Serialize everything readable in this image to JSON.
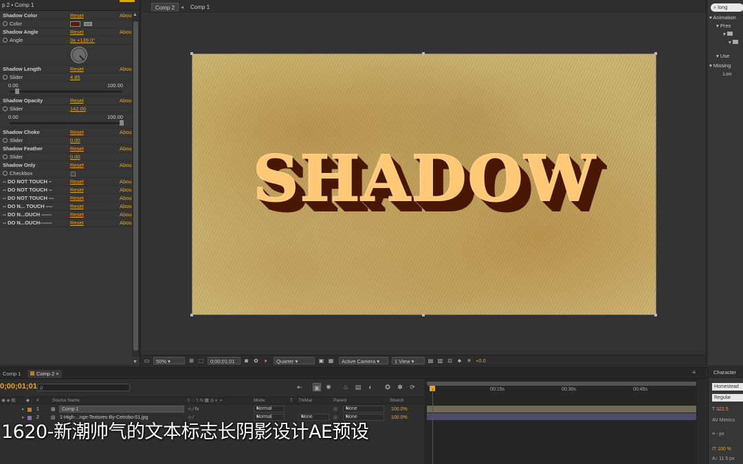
{
  "effect_controls": {
    "header": "p 2 • Comp 1",
    "rows": [
      {
        "type": "group",
        "name": "Shadow Color",
        "reset": "Reset",
        "about": "Abou"
      },
      {
        "type": "color",
        "name": "Color"
      },
      {
        "type": "group",
        "name": "Shadow Angle",
        "reset": "Reset",
        "about": "Abou"
      },
      {
        "type": "value",
        "name": "Angle",
        "value": "0x +139.0°"
      },
      {
        "type": "dial"
      },
      {
        "type": "group",
        "name": "Shadow Length",
        "reset": "Reset",
        "about": "Abou"
      },
      {
        "type": "value",
        "name": "Slider",
        "value": "4.85"
      },
      {
        "type": "range",
        "lo": "0.00",
        "hi": "100.00",
        "fraction": 0.05
      },
      {
        "type": "group",
        "name": "Shadow Opacity",
        "reset": "Reset",
        "about": "Abou"
      },
      {
        "type": "value",
        "name": "Slider",
        "value": "142.00"
      },
      {
        "type": "range",
        "lo": "0.00",
        "hi": "100.00",
        "fraction": 1.0
      },
      {
        "type": "group",
        "name": "Shadow Choke",
        "reset": "Reset",
        "about": "Abou"
      },
      {
        "type": "value",
        "name": "Slider",
        "value": "0.00"
      },
      {
        "type": "group",
        "name": "Shadow Feather",
        "reset": "Reset",
        "about": "Abou"
      },
      {
        "type": "value",
        "name": "Slider",
        "value": "0.00"
      },
      {
        "type": "group",
        "name": "Shadow Only",
        "reset": "Reset",
        "about": "Abou"
      },
      {
        "type": "check",
        "name": "Checkbox"
      },
      {
        "type": "group",
        "name": "-- DO NOT TOUCH –",
        "reset": "Reset",
        "about": "Abou"
      },
      {
        "type": "group",
        "name": "-- DO NOT TOUCH --",
        "reset": "Reset",
        "about": "Abou"
      },
      {
        "type": "group",
        "name": "-- DO NOT TOUCH ---",
        "reset": "Reset",
        "about": "Abou"
      },
      {
        "type": "group",
        "name": "-- DO N... TOUCH ----",
        "reset": "Reset",
        "about": "Abou"
      },
      {
        "type": "group",
        "name": "-- DO N...OUCH ------",
        "reset": "Reset",
        "about": "Abou"
      },
      {
        "type": "group",
        "name": "-- DO N...OUCH-------",
        "reset": "Reset",
        "about": "Abou"
      }
    ]
  },
  "viewer": {
    "tabs": [
      "Comp 2",
      "Comp 1"
    ],
    "comp_text": "SHADOW",
    "bottom_bar": {
      "zoom": "50%",
      "timecode": "0;00;01;01",
      "resolution": "Quarter",
      "camera": "Active Camera",
      "views": "1 View",
      "exposure": "+0.0"
    }
  },
  "right_panel": {
    "search": "long",
    "tree": [
      "▾ Animation",
      "▾ Pres",
      "▾",
      "▾",
      "▾ Use",
      "▾ Missing",
      "Lon"
    ]
  },
  "timeline": {
    "tabs": [
      "Comp 1",
      "Comp 2"
    ],
    "timecode": "0;00;01;01",
    "search_placeholder": "ρ",
    "columns": {
      "source": "Source Name",
      "mode": "Mode",
      "t": "T",
      "trkmat": "TrkMat",
      "parent": "Parent",
      "stretch": "Stretch"
    },
    "layers": [
      {
        "num": "1",
        "name": "Comp 1",
        "mode": "Normal",
        "trkmat": "",
        "parent": "None",
        "stretch": "100.0%"
      },
      {
        "num": "2",
        "name": "1-High-...nge-Textures-By-Cetrobo-01.jpg",
        "mode": "Normal",
        "trkmat": "None",
        "parent": "None",
        "stretch": "100.0%"
      }
    ],
    "ruler": [
      "00:15s",
      "00:30s",
      "00:45s"
    ]
  },
  "character_panel": {
    "title": "Character",
    "font": "Homestead",
    "style": "Regular",
    "size": "322.5",
    "tracking_label": "Metrics",
    "leading": "- px",
    "scale": "100 %",
    "baseline": "11.5 px"
  },
  "caption": "1620-新潮帅气的文本标志长阴影设计AE预设",
  "colors": {
    "accent": "#e6a52a",
    "shadow": "#4a1705",
    "text_fill": "#ffc876",
    "panel": "#363636"
  }
}
